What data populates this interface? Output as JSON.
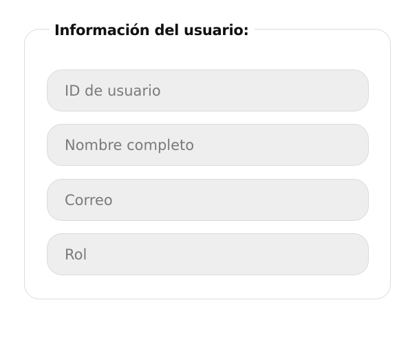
{
  "form": {
    "legend": "Información del usuario:",
    "fields": [
      {
        "placeholder": "ID de usuario",
        "value": ""
      },
      {
        "placeholder": "Nombre completo",
        "value": ""
      },
      {
        "placeholder": "Correo",
        "value": ""
      },
      {
        "placeholder": "Rol",
        "value": ""
      }
    ]
  }
}
